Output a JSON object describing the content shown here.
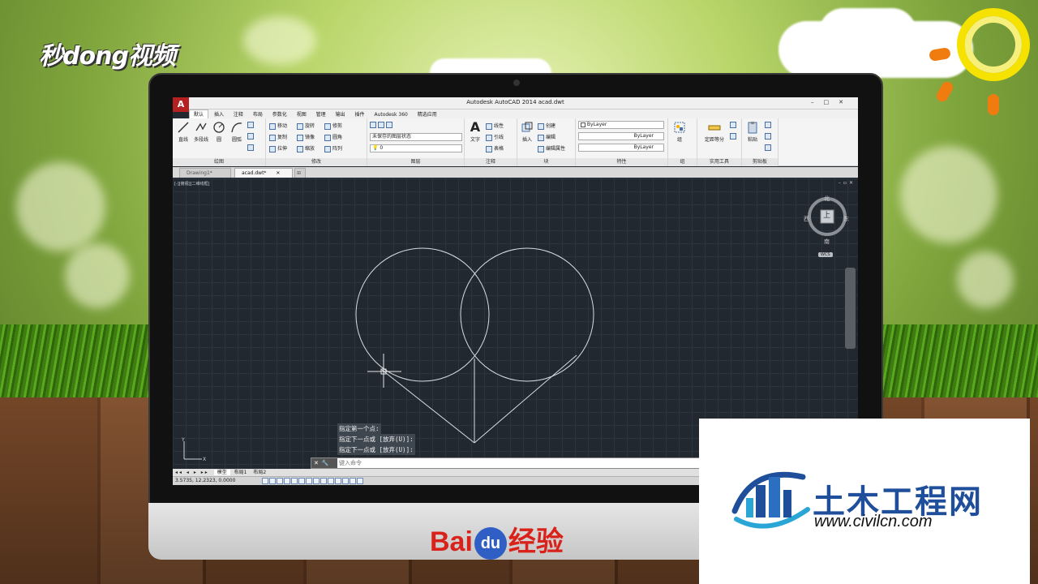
{
  "scene": {
    "brand_logo_text": "秒dong视频",
    "monitor_brand": {
      "left": "Bai",
      "badge": "du",
      "right": "经验"
    }
  },
  "app": {
    "title": "Autodesk AutoCAD 2014    acad.dwt",
    "logo": "A"
  },
  "menu_tabs": [
    "默认",
    "插入",
    "注释",
    "布局",
    "参数化",
    "视图",
    "管理",
    "输出",
    "插件",
    "Autodesk 360",
    "精选应用"
  ],
  "ribbon": {
    "panels": {
      "draw": "绘图",
      "modify": "修改",
      "layers": "图层",
      "annotation": "注释",
      "block": "块",
      "properties": "特性",
      "groups": "组",
      "utilities": "实用工具",
      "clipboard": "剪贴板"
    },
    "draw_tools": [
      "直线",
      "多段线",
      "圆",
      "圆弧"
    ],
    "modify_tools": [
      "移动",
      "旋转",
      "修剪",
      "复制",
      "镜像",
      "圆角",
      "拉伸",
      "缩放",
      "阵列"
    ],
    "layer_state": "未保存的图层状态",
    "layer_current": "0",
    "annotation_tools": {
      "text": "文字",
      "dimension": "线性",
      "leader": "引线",
      "table": "表格"
    },
    "block_tools": {
      "insert": "插入",
      "create": "创建",
      "edit": "编辑",
      "edit_attr": "编辑属性"
    },
    "properties": {
      "color": "ByLayer",
      "linetype": "ByLayer",
      "lineweight": "ByLayer"
    },
    "groups_label": "组",
    "measure": "定距等分",
    "paste": "粘贴"
  },
  "doc_tabs": [
    {
      "label": "Drawing1*",
      "active": false
    },
    {
      "label": "acad.dwt*",
      "active": true
    }
  ],
  "viewport": {
    "label": "[-][俯视][二维线框]",
    "viewcube": {
      "north": "北",
      "south": "南",
      "east": "东",
      "west": "西",
      "face": "上",
      "wcs": "WCS"
    }
  },
  "command_history": [
    "指定第一个点:",
    "指定下一点或 [放弃(U)]:",
    "指定下一点或 [放弃(U)]:"
  ],
  "command_line": {
    "placeholder": "键入命令"
  },
  "layout_tabs": [
    "模型",
    "布局1",
    "布局2"
  ],
  "status_bar": {
    "coords": "3.5735,  12.2323,  0.0000"
  },
  "watermark": {
    "title": "土木工程网",
    "url": "www.civilcn.com"
  },
  "colors": {
    "accent_blue": "#1f4f9b",
    "baidu_red": "#d8221a",
    "canvas_bg": "#212830",
    "drawing_line": "#d8dde3"
  }
}
